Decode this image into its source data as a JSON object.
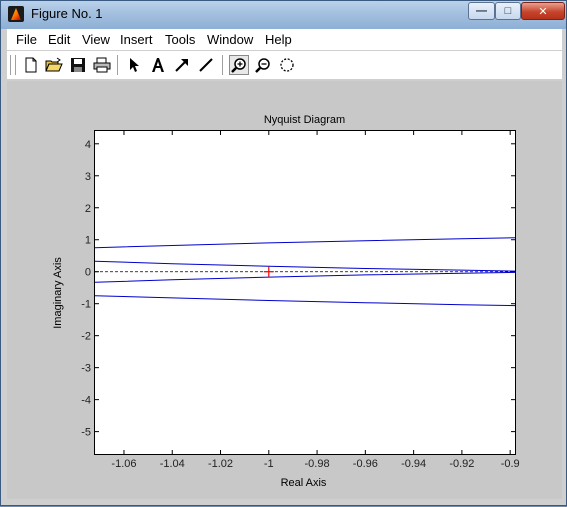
{
  "window": {
    "title": "Figure No. 1",
    "controls": {
      "minimize": "—",
      "maximize": "□",
      "close": "✕"
    }
  },
  "menubar": {
    "items": [
      "File",
      "Edit",
      "View",
      "Insert",
      "Tools",
      "Window",
      "Help"
    ]
  },
  "toolbar": {
    "tools": [
      "new-icon",
      "open-icon",
      "save-icon",
      "print-icon",
      "select-arrow-icon",
      "text-icon",
      "arrow-icon",
      "line-icon",
      "zoom-in-icon",
      "zoom-out-icon",
      "rotate-icon"
    ],
    "active_tool": "zoom-in-icon"
  },
  "chart_data": {
    "type": "line",
    "title": "Nyquist Diagram",
    "xlabel": "Real Axis",
    "ylabel": "Imaginary Axis",
    "xlim": [
      -1.072,
      -0.898
    ],
    "ylim": [
      -5.7,
      4.4
    ],
    "xticks": [
      -1.06,
      -1.04,
      -1.02,
      -1,
      -0.98,
      -0.96,
      -0.94,
      -0.92,
      -0.9
    ],
    "xtick_labels": [
      "-1.06",
      "-1.04",
      "-1.02",
      "-1",
      "-0.98",
      "-0.96",
      "-0.94",
      "-0.92",
      "-0.9"
    ],
    "yticks": [
      4,
      3,
      2,
      1,
      0,
      -1,
      -2,
      -3,
      -4,
      -5
    ],
    "ytick_labels": [
      "4",
      "3",
      "2",
      "1",
      "0",
      "-1",
      "-2",
      "-3",
      "-4",
      "-5"
    ],
    "grid": false,
    "line_color": "#0000cc",
    "series": [
      {
        "x": [
          -1.072,
          -1.04,
          -1.0,
          -0.96,
          -0.92,
          -0.898
        ],
        "y": [
          0.75,
          0.82,
          0.9,
          0.97,
          1.03,
          1.06
        ]
      },
      {
        "x": [
          -1.072,
          -1.04,
          -1.0,
          -0.96,
          -0.92,
          -0.898
        ],
        "y": [
          -0.75,
          -0.82,
          -0.9,
          -0.97,
          -1.03,
          -1.06
        ]
      },
      {
        "x": [
          -1.072,
          -1.04,
          -1.0,
          -0.96,
          -0.92,
          -0.898
        ],
        "y": [
          0.33,
          0.25,
          0.17,
          0.1,
          0.05,
          0.02
        ]
      },
      {
        "x": [
          -1.072,
          -1.04,
          -1.0,
          -0.96,
          -0.92,
          -0.898
        ],
        "y": [
          -0.33,
          -0.25,
          -0.17,
          -0.1,
          -0.05,
          -0.02
        ]
      }
    ],
    "reference_line": {
      "y": 0,
      "style": "dashed",
      "color": "#000000"
    },
    "critical_point": {
      "x": -1,
      "y": 0,
      "marker": "+",
      "color": "#ff0000"
    }
  }
}
